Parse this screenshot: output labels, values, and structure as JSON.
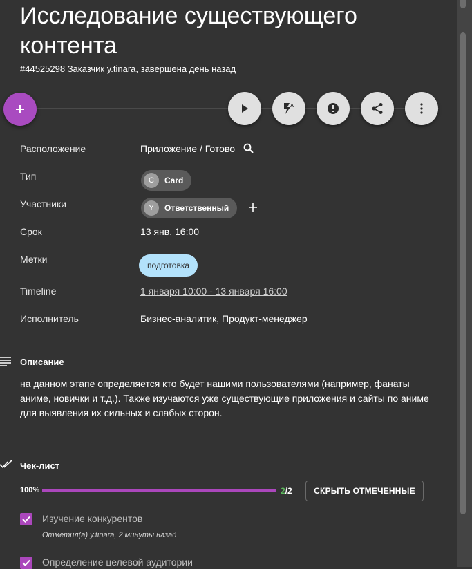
{
  "card": {
    "title": "Исследование существующего контента",
    "id_link": "#44525298",
    "customer_prefix": "Заказчик",
    "customer_link": "y.tinara",
    "status_text": ", завершена день назад"
  },
  "actions": {
    "add": "add-icon",
    "items": [
      "play-icon",
      "flash-auto-icon",
      "alert-icon",
      "share-icon",
      "more-vert-icon"
    ]
  },
  "fields": {
    "location": {
      "label": "Расположение",
      "value": "Приложение / Готово"
    },
    "type": {
      "label": "Тип",
      "avatar": "C",
      "value": "Card"
    },
    "members": {
      "label": "Участники",
      "avatar": "Y",
      "value": "Ответственный"
    },
    "due": {
      "label": "Срок",
      "value": "13 янв. 16:00"
    },
    "tags": {
      "label": "Метки",
      "value": "подготовка"
    },
    "timeline": {
      "label": "Timeline",
      "value": "1 января 10:00 - 13 января 16:00"
    },
    "assignee": {
      "label": "Исполнитель",
      "value": "Бизнес-аналитик, Продукт-менеджер"
    }
  },
  "description": {
    "title": "Описание",
    "text": "на данном этапе определяется кто будет нашими пользователями (например, фанаты аниме, новички и т.д.). Также изучаются уже существующие приложения и сайты по аниме для выявления их сильных и слабых сторон."
  },
  "checklist": {
    "title": "Чек-лист",
    "percent_label": "100%",
    "progress": 1.0,
    "done": "2",
    "total": "/2",
    "hide_button": "СКРЫТЬ ОТМЕЧЕННЫЕ",
    "items": [
      {
        "label": "Изучение конкурентов",
        "meta": "Отметил(а) y.tinara, 2 минуты назад"
      },
      {
        "label": "Определение целевой аудитории"
      }
    ]
  },
  "colors": {
    "background": "#333333",
    "accent": "#ab47bc",
    "tag": "#b3e2fb",
    "done": "#5cb85c"
  }
}
